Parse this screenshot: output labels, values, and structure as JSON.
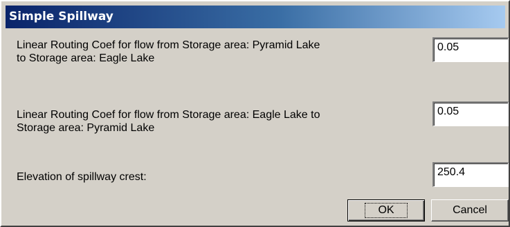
{
  "window": {
    "title": "Simple Spillway"
  },
  "fields": [
    {
      "label_line1": "Linear Routing Coef for flow from Storage area: Pyramid Lake",
      "label_line2": "to Storage area: Eagle Lake",
      "value": "0.05"
    },
    {
      "label_line1": "Linear Routing Coef for flow from Storage area: Eagle Lake to",
      "label_line2": "Storage area: Pyramid Lake",
      "value": "0.05"
    },
    {
      "label_line1": "Elevation of spillway crest:",
      "value": "250.4"
    }
  ],
  "buttons": {
    "ok_label": "OK",
    "cancel_label": "Cancel"
  },
  "colors": {
    "title_bar_start": "#0a246a",
    "title_bar_end": "#a6caf0",
    "dialog_face": "#d4d0c8"
  }
}
